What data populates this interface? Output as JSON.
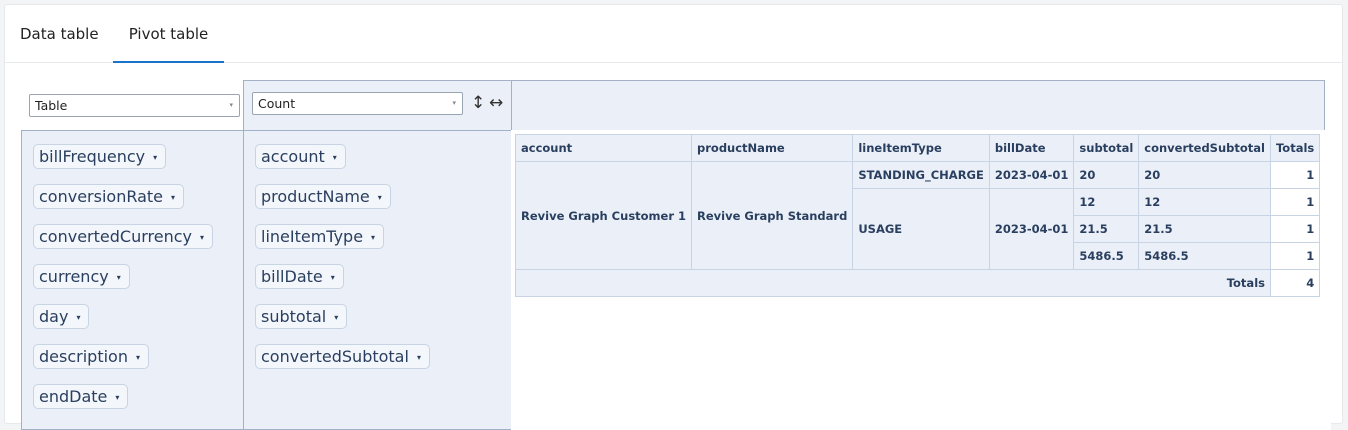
{
  "tabs": [
    {
      "label": "Data table",
      "active": false
    },
    {
      "label": "Pivot table",
      "active": true
    }
  ],
  "renderer": {
    "value": "Table"
  },
  "aggregator": {
    "value": "Count"
  },
  "icons": {
    "row_order": "↕",
    "col_order": "↔",
    "dropdown": "▾"
  },
  "unused_attributes": [
    "billFrequency",
    "conversionRate",
    "convertedCurrency",
    "currency",
    "day",
    "description",
    "endDate"
  ],
  "row_attributes": [
    "account",
    "productName",
    "lineItemType",
    "billDate",
    "subtotal",
    "convertedSubtotal"
  ],
  "pivot": {
    "headers": [
      "account",
      "productName",
      "lineItemType",
      "billDate",
      "subtotal",
      "convertedSubtotal",
      "Totals"
    ],
    "account": "Revive Graph Customer 1",
    "product": "Revive Graph Standard",
    "line_item_types": [
      "STANDING_CHARGE",
      "USAGE"
    ],
    "bill_dates": [
      "2023-04-01",
      "2023-04-01"
    ],
    "rows": [
      {
        "subtotal": "20",
        "converted": "20",
        "total": "1"
      },
      {
        "subtotal": "12",
        "converted": "12",
        "total": "1"
      },
      {
        "subtotal": "21.5",
        "converted": "21.5",
        "total": "1"
      },
      {
        "subtotal": "5486.5",
        "converted": "5486.5",
        "total": "1"
      }
    ],
    "totals_label": "Totals",
    "grand_total": "4"
  }
}
